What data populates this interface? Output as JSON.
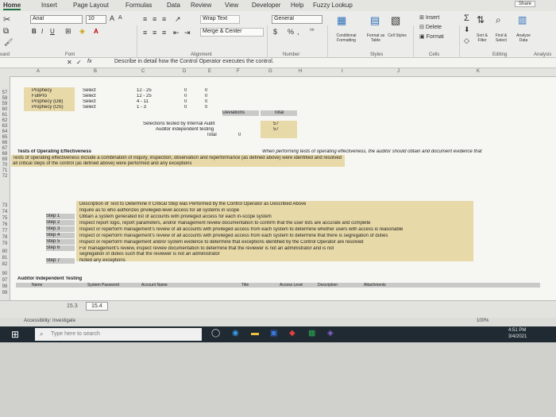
{
  "tabs": [
    "Home",
    "Insert",
    "Page Layout",
    "Formulas",
    "Data",
    "Review",
    "View",
    "Developer",
    "Help",
    "Fuzzy Lookup"
  ],
  "share_label": "Share",
  "ribbon": {
    "font_name": "Arial",
    "font_size": "10",
    "grow_font": "A",
    "shrink_font": "A",
    "bold": "B",
    "italic": "I",
    "underline": "U",
    "wrap_text": "Wrap Text",
    "merge_center": "Merge & Center",
    "number_format": "General",
    "currency": "$",
    "percent": "%",
    "comma": ",",
    "conditional_formatting": "Conditional Formatting",
    "format_as_table": "Format as Table",
    "cell_styles": "Cell Styles",
    "insert": "Insert",
    "delete": "Delete",
    "format": "Format",
    "sigma": "Σ",
    "sort_filter": "Sort & Filter",
    "find_select": "Find & Select",
    "analyze_data": "Analyze Data",
    "groups": {
      "clipboard": "oard",
      "font": "Font",
      "alignment": "Alignment",
      "number": "Number",
      "styles": "Styles",
      "cells": "Cells",
      "editing": "Editing",
      "analysis": "Analysis"
    }
  },
  "formula_bar": {
    "fx": "fx",
    "content": "Describe in detail how the Control Operator executes the control."
  },
  "columns": [
    "A",
    "B",
    "C",
    "D",
    "E",
    "F",
    "G",
    "H",
    "I",
    "J",
    "K"
  ],
  "rows": {
    "r57": {
      "n": "57",
      "a": "Prophecy",
      "b": "Select",
      "c": "12 - 25",
      "d": "0",
      "e": "0"
    },
    "r58": {
      "n": "58",
      "a": "FullPro",
      "b": "Select",
      "c": "12 - 25",
      "d": "0",
      "e": "0"
    },
    "r59": {
      "n": "59",
      "a": "Prophecy (DB)",
      "b": "Select",
      "c": "4 - 11",
      "d": "0",
      "e": "0"
    },
    "r60": {
      "n": "60",
      "a": "Prophecy (OS)",
      "b": "Select",
      "c": "1 - 3",
      "d": "0",
      "e": "0"
    },
    "r61": {
      "n": "61",
      "f": "Deviations",
      "h": "Total"
    },
    "r62": {
      "n": "62"
    },
    "r63": {
      "n": "63",
      "e": "Selections tested by Internal Audit",
      "h": "57"
    },
    "r64": {
      "n": "64",
      "e": "Auditor independent testing",
      "h": "57"
    },
    "r65": {
      "n": "65",
      "e": "Total",
      "g": "0"
    },
    "r66": {
      "n": "66"
    },
    "r67": {
      "n": "67"
    },
    "r68": {
      "n": "68",
      "a": "Tests of Operating Effectiveness",
      "e": "When performing tests of operating effectiveness, the auditor should obtain and document evidence that"
    },
    "r69": {
      "n": "69"
    },
    "r70": {
      "n": "70",
      "a": "Tests of operating effectiveness include a combination of inquiry, inspection, observation and reperformance (as defined above) were identified and resolved"
    },
    "r71": {
      "n": "71",
      "a": "all critical steps of the control (as defined above) were performed and any exceptions"
    },
    "r72": {
      "n": "72"
    },
    "r73": {
      "n": "73",
      "c": "Description of Test to Determine if Critical Step was Performed by the Control Operator as Described Above"
    },
    "r74": {
      "n": "74",
      "c": "Inquire as to who authorizes privileged-level access for all systems in scope"
    },
    "r75": {
      "n": "75",
      "b": "Step 1",
      "c": "Obtain a system generated list of accounts with privileged access for each in-scope system"
    },
    "r76": {
      "n": "76",
      "b": "Step 2",
      "c": "Inspect report logic, report parameters, and/or management review documentation to confirm that the user lists are accurate and complete"
    },
    "r77": {
      "n": "77",
      "b": "Step 3",
      "c": "Inspect or reperform management's review of all accounts with privileged access from each system to determine whether users with access is reasonable"
    },
    "r78": {
      "n": "78",
      "b": "Step 4",
      "c": "Inspect or reperform management's review of all accounts with privileged access from each system to determine that there is segregation of duties"
    },
    "r79": {
      "n": "79",
      "b": "Step 5",
      "c": "Inspect or reperform management and/or system evidence to determine that exceptions identified by the Control Operator are resolved"
    },
    "r80": {
      "n": "80",
      "b": "Step 6",
      "c": "For management's review, inspect review documentation to determine that the reviewer is not an administrator and is not reviewing his/her own access"
    },
    "r81": {
      "n": "81",
      "c": "segregation of duties such that the reviewer is not an administrator"
    },
    "r82": {
      "n": "82",
      "b": "Step 7",
      "c": "Noted any exceptions"
    },
    "r90": {
      "n": "90"
    },
    "r97": {
      "n": "97"
    },
    "r98": {
      "n": "98",
      "a": "Auditor Independent Testing"
    },
    "r99": {
      "n": "99"
    }
  },
  "bottom_grid": {
    "hdr_a": "Name",
    "hdr_b": "System Password",
    "hdr_c": "Account Name",
    "hdr_d": "Title",
    "hdr_e": "Access Level",
    "hdr_f": "Description",
    "hdr_g": "Attachments",
    "val1": "15.3",
    "val2": "15.4"
  },
  "status": {
    "accessibility": "Accessibility: Investigate",
    "zoom": "100%"
  },
  "taskbar": {
    "search_placeholder": "Type here to search",
    "time": "4:51 PM",
    "date": "3/4/2021"
  }
}
